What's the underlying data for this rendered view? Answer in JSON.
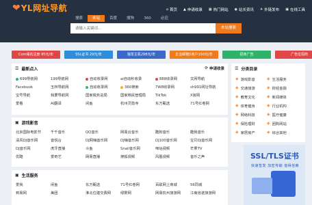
{
  "header": {
    "logo_mark": "❤",
    "logo_text": "YL网址导航",
    "nav": [
      {
        "icon": "home-icon",
        "glyph": "⌂",
        "label": "首页"
      },
      {
        "icon": "user-icon",
        "glyph": "▲",
        "label": "申请收录"
      },
      {
        "icon": "fire-icon",
        "glyph": "▦",
        "label": "热门网站"
      },
      {
        "icon": "user-icon",
        "glyph": "◉",
        "label": "站长资讯"
      },
      {
        "icon": "link-icon",
        "glyph": "✈",
        "label": "外链发布"
      },
      {
        "icon": "gear-icon",
        "glyph": "▣",
        "label": "在线工具"
      }
    ]
  },
  "search": {
    "tabs": [
      "搜索",
      "本站",
      "百度",
      "搜狗",
      "360",
      "必应"
    ],
    "active_tab": 1,
    "placeholder": "请输入关键词...",
    "button": "本站搜索"
  },
  "quick_buttons": [
    {
      "label": "Com域名注册 95元/年",
      "color": "#e04848"
    },
    {
      "label": "SSL证书 29元/年",
      "color": "#2f8ddc"
    },
    {
      "label": "独享主机298元/年",
      "color": "#3a68c8"
    },
    {
      "label": "企业邮箱5用户150元/年",
      "color": "#f07b1c"
    },
    {
      "label": "招商广告",
      "color": "#2fb26a"
    },
    {
      "label": "广告位招商",
      "color": "#e04848"
    }
  ],
  "latest": {
    "title": "最新点入",
    "right_label": "申请收录",
    "items": [
      {
        "label": "699导航网",
        "dot": "#2fb26a"
      },
      {
        "label": "199导航网",
        "dot": ""
      },
      {
        "label": "自动收录网",
        "dot": "#e04848"
      },
      {
        "label": "ai自动秒收录",
        "dot": ""
      },
      {
        "label": "888收录网",
        "dot": "#e04848"
      },
      {
        "label": "文网导航",
        "dot": ""
      },
      {
        "label": "Facebook",
        "dot": ""
      },
      {
        "label": "玉林导航网",
        "dot": ""
      },
      {
        "label": "自动收录网",
        "dot": "#2fb26a"
      },
      {
        "label": "360搜索",
        "dot": "#f0b020"
      },
      {
        "label": "7W8收录网",
        "dot": ""
      },
      {
        "label": "sh991网址导航",
        "dot": ""
      },
      {
        "label": "宝号导航",
        "dot": ""
      },
      {
        "label": "我要导航网",
        "dot": ""
      },
      {
        "label": "国家税务总局",
        "dot": ""
      },
      {
        "label": "国家移民管理局",
        "dot": ""
      },
      {
        "label": "TikTok",
        "dot": ""
      },
      {
        "label": "X官网",
        "dot": ""
      },
      {
        "label": "爱看",
        "dot": ""
      },
      {
        "label": "AI翻译",
        "dot": ""
      },
      {
        "label": "闲鱼",
        "dot": ""
      },
      {
        "label": "杭州灵隐寺",
        "dot": ""
      },
      {
        "label": "东方甄选",
        "dot": ""
      },
      {
        "label": "71号红卷网",
        "dot": ""
      }
    ]
  },
  "categories": {
    "title": "分类目录",
    "items": [
      {
        "icon": "gamepad-icon",
        "glyph": "◈",
        "label": "游戏影音"
      },
      {
        "icon": "life-icon",
        "glyph": "◈",
        "label": "生活服务"
      },
      {
        "icon": "travel-icon",
        "glyph": "◈",
        "label": "交通旅游"
      },
      {
        "icon": "finance-icon",
        "glyph": "◈",
        "label": "财经金融"
      },
      {
        "icon": "education-icon",
        "glyph": "◈",
        "label": "教育文化"
      },
      {
        "icon": "chart-icon",
        "glyph": "◈",
        "label": "新闻媒体"
      },
      {
        "icon": "sports-icon",
        "glyph": "◈",
        "label": "体育健身"
      },
      {
        "icon": "industry-icon",
        "glyph": "◈",
        "label": "行业机构"
      },
      {
        "icon": "network-icon",
        "glyph": "◈",
        "label": "网络科技"
      },
      {
        "icon": "health-icon",
        "glyph": "◈",
        "label": "医疗健康"
      },
      {
        "icon": "site-icon",
        "glyph": "◈",
        "label": "保险理财"
      },
      {
        "icon": "shop-icon",
        "glyph": "◈",
        "label": "团购网站"
      },
      {
        "icon": "home-icon",
        "glyph": "◈",
        "label": "家居房产"
      },
      {
        "icon": "all-icon",
        "glyph": "◈",
        "label": "综合其他"
      }
    ]
  },
  "games": {
    "title": "游戏影音",
    "items": [
      "北京国际电影节",
      "千千音乐",
      "QQ音乐",
      "网易云音乐",
      "酷狗音乐",
      "酷我音乐",
      "清风DJ音乐网",
      "音悦台",
      "DJ网嗨音乐网",
      "DJ嗨音乐网",
      "DJ100音乐网",
      "宝贝DJ音乐网",
      "DJ音乐网",
      "虎牙直播",
      "斗鱼",
      "Snail音乐网",
      "咪咕视频",
      "芒果TV",
      "优酷",
      "爱奇艺",
      "网易直播",
      "搜狐视频",
      "风凰视频",
      "音乐之声"
    ]
  },
  "life": {
    "title": "生活服务",
    "items": [
      "爱我",
      "闲鱼",
      "东方甄选",
      "71号红卷网",
      "百联网上商城",
      "56同城",
      "到易网",
      "美团",
      "淮北住建交费网",
      "绿雾网",
      "网易杭州旅游网",
      "江南信诺旅游网"
    ]
  },
  "ad": {
    "title": "SSL/TLS证书",
    "subtitle": "快速签发  加密传输  值得信赖"
  }
}
